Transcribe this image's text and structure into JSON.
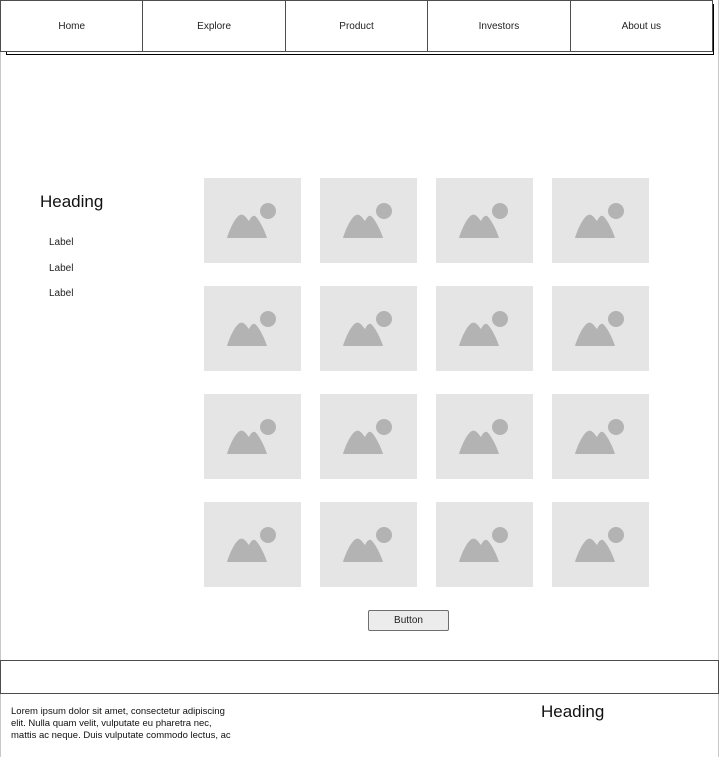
{
  "nav": {
    "items": [
      {
        "label": "Home"
      },
      {
        "label": "Explore"
      },
      {
        "label": "Product"
      },
      {
        "label": "Investors"
      },
      {
        "label": "About us"
      }
    ]
  },
  "sidebar": {
    "heading": "Heading",
    "labels": [
      "Label",
      "Label",
      "Label"
    ]
  },
  "gallery": {
    "rows": 4,
    "columns": 4,
    "placeholder_icon": "image-placeholder-icon"
  },
  "main": {
    "button_label": "Button"
  },
  "footer": {
    "text_lines": [
      "Lorem ipsum dolor sit amet, consectetur adipiscing",
      "elit. Nulla quam velit, vulputate eu pharetra nec,",
      "mattis ac neque. Duis vulputate commodo lectus, ac"
    ],
    "heading": "Heading"
  }
}
